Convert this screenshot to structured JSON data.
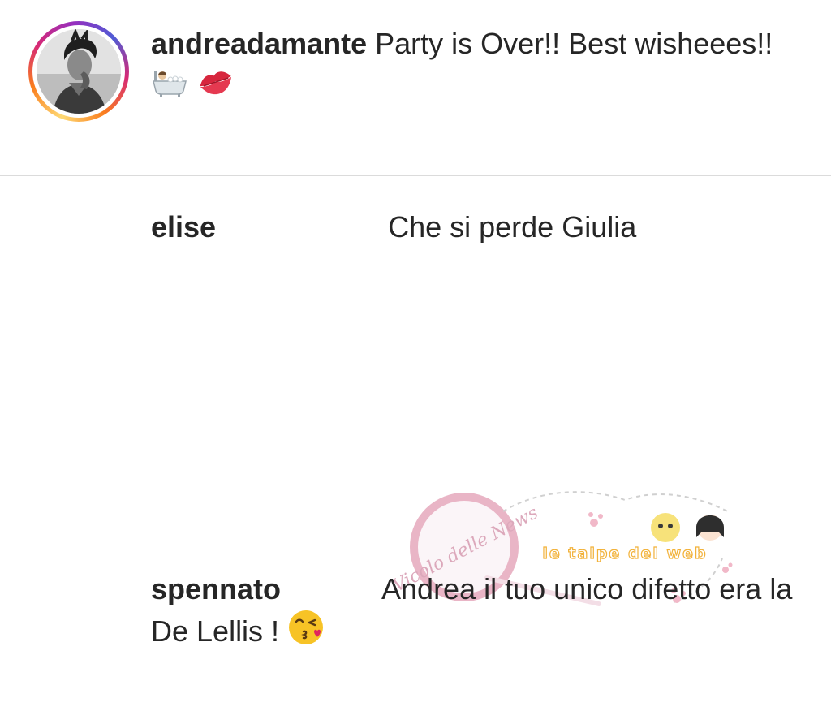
{
  "post": {
    "username": "andreadamante",
    "caption": "Party is Over!! Best wisheees!!",
    "caption_emojis": [
      "bathtub-icon",
      "kiss-mark-icon"
    ]
  },
  "comments": [
    {
      "username": "elise",
      "text": "Che si perde Giulia"
    },
    {
      "username": "spennato",
      "text": "Andrea il tuo unico difetto era la De Lellis !",
      "emoji": "kissing-face-icon"
    }
  ],
  "watermark": {
    "stamp_text": "Vicolo delle News",
    "banner_text": "le talpe del web"
  },
  "colors": {
    "text": "#262626",
    "divider": "#dbdbdb",
    "kiss": "#d7263d",
    "emoji_yellow": "#f7c326",
    "watermark_pink": "#e6a9bd"
  }
}
